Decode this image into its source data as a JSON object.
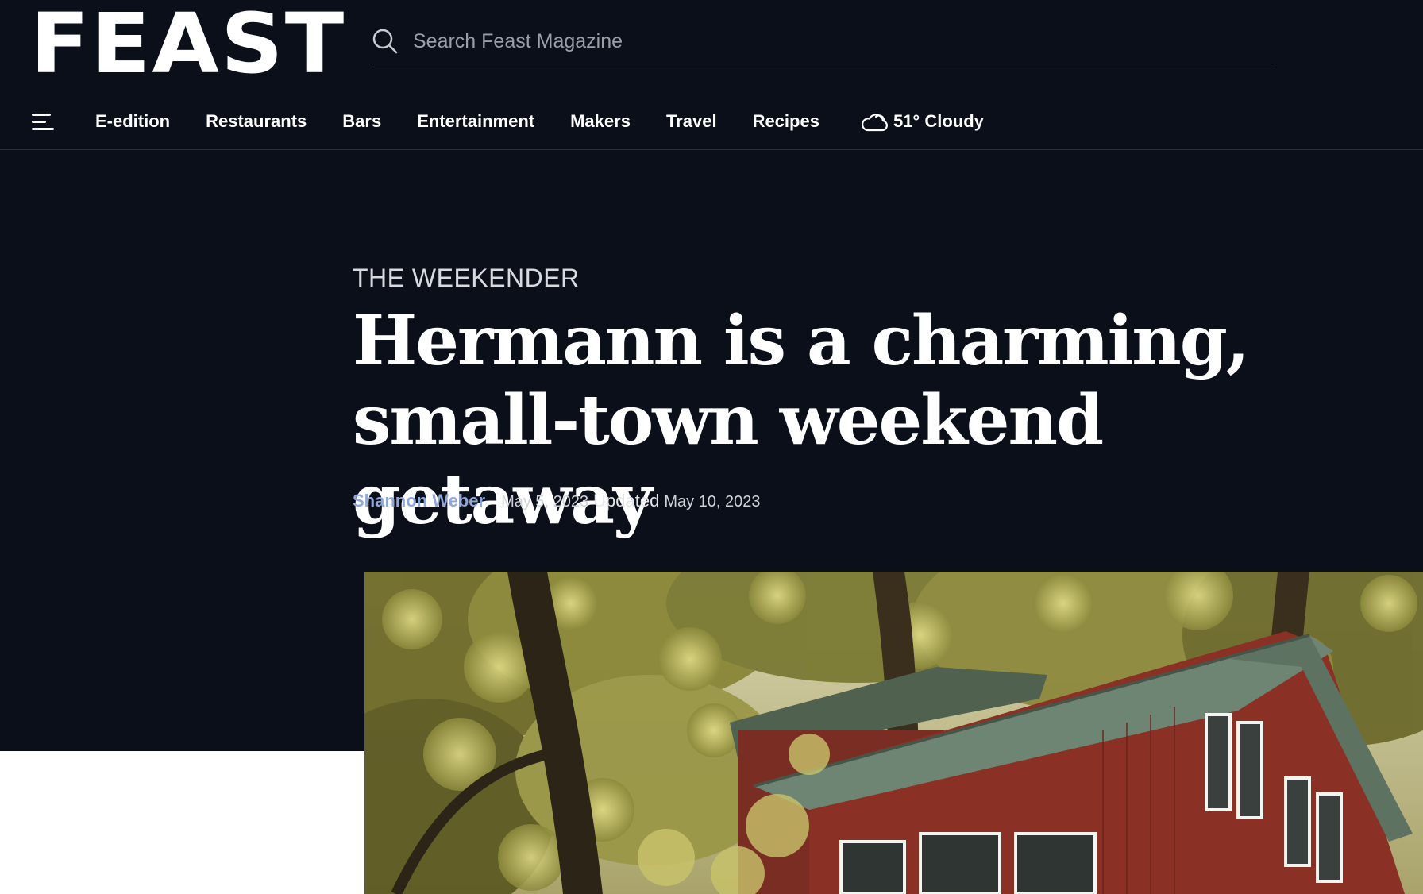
{
  "header": {
    "logo_text": "FEAST",
    "search_placeholder": "Search Feast Magazine",
    "search_value": ""
  },
  "nav": {
    "items": [
      {
        "label": "E-edition"
      },
      {
        "label": "Restaurants"
      },
      {
        "label": "Bars"
      },
      {
        "label": "Entertainment"
      },
      {
        "label": "Makers"
      },
      {
        "label": "Travel"
      },
      {
        "label": "Recipes"
      }
    ],
    "weather": {
      "icon": "cloud-icon",
      "label": "51° Cloudy"
    }
  },
  "article": {
    "kicker": "THE WEEKENDER",
    "headline": "Hermann is a charming, small-town weekend getaway",
    "author": "Shannon Weber",
    "published": "May 5, 2023",
    "updated_label": "Updated",
    "updated": "May 10, 2023"
  },
  "colors": {
    "background": "#0b0f1a",
    "author_link": "#8fa8d8",
    "text": "#ffffff"
  }
}
